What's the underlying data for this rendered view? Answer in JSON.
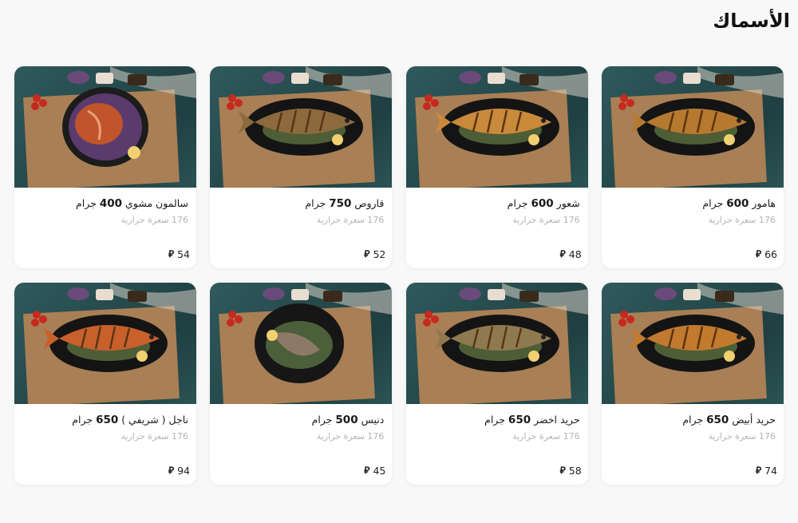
{
  "section": {
    "title": "الأسماك"
  },
  "currency_symbol": "⃁",
  "items": [
    {
      "name": "هامور",
      "weight": "600",
      "unit": "جرام",
      "calories": "176 سعرة حرارية",
      "price": "66",
      "dish": "fish",
      "fish_color": "#b5792f"
    },
    {
      "name": "شعور",
      "weight": "600",
      "unit": "جرام",
      "calories": "176 سعرة حرارية",
      "price": "48",
      "dish": "fish",
      "fish_color": "#c98a3c"
    },
    {
      "name": "قاروص",
      "weight": "750",
      "unit": "جرام",
      "calories": "176 سعرة حرارية",
      "price": "52",
      "dish": "fish",
      "fish_color": "#8c6a3e"
    },
    {
      "name": "سالمون مشوي",
      "weight": "400",
      "unit": "جرام",
      "calories": "176 سعرة حرارية",
      "price": "54",
      "dish": "salmon",
      "fish_color": "#c0542a"
    },
    {
      "name": "حريد أبيض",
      "weight": "650",
      "unit": "جرام",
      "calories": "176 سعرة حرارية",
      "price": "74",
      "dish": "fish",
      "fish_color": "#c27a2e"
    },
    {
      "name": "حريد اخضر",
      "weight": "650",
      "unit": "جرام",
      "calories": "176 سعرة حرارية",
      "price": "58",
      "dish": "fish",
      "fish_color": "#8f7a50"
    },
    {
      "name": "دنيس",
      "weight": "500",
      "unit": "جرام",
      "calories": "176 سعرة حرارية",
      "price": "45",
      "dish": "fish-small",
      "fish_color": "#8c7a66"
    },
    {
      "name": "ناجل ( شريفي )",
      "weight": "650",
      "unit": "جرام",
      "calories": "176 سعرة حرارية",
      "price": "94",
      "dish": "fish",
      "fish_color": "#c8602c"
    }
  ]
}
